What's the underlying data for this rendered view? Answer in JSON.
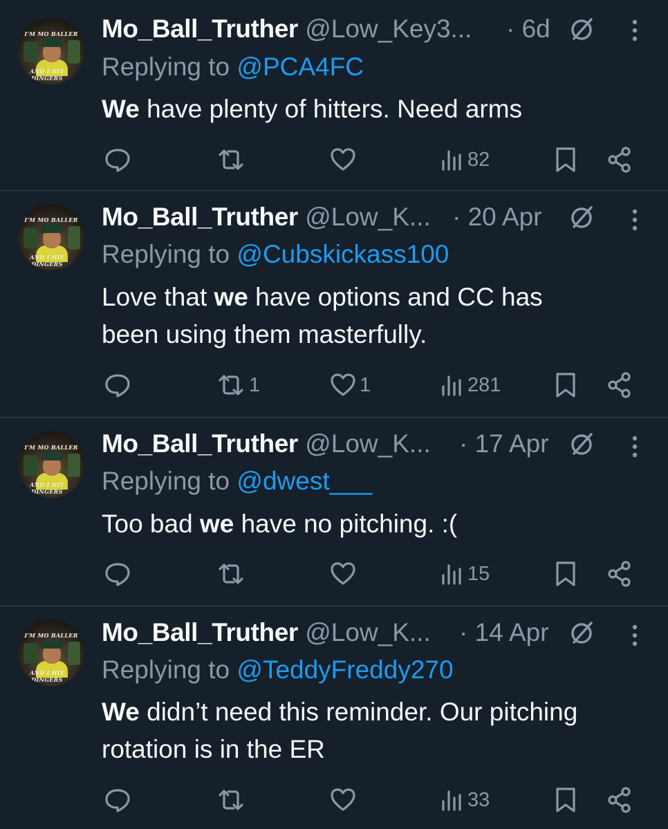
{
  "avatar": {
    "top_text": "I'M MO BALLER",
    "bottom_text": "AND I HIT DINGERS"
  },
  "tweets": [
    {
      "name": "Mo_Ball_Truther",
      "handle": "@Low_Key3...",
      "time": "· 6d",
      "replying_label": "Replying to",
      "replying_to": "@PCA4FC",
      "text_bold": "We",
      "text_rest": " have plenty of hitters. Need arms",
      "text_line2": "",
      "replies": "",
      "retweets": "",
      "likes": "",
      "views": "82"
    },
    {
      "name": "Mo_Ball_Truther",
      "handle": "@Low_K...",
      "time": "· 20 Apr",
      "replying_label": "Replying to",
      "replying_to": "@Cubskickass100",
      "text_pre": "Love that ",
      "text_bold": "we",
      "text_rest": " have options and CC has",
      "text_line2": "been using them masterfully.",
      "replies": "",
      "retweets": "1",
      "likes": "1",
      "views": "281"
    },
    {
      "name": "Mo_Ball_Truther",
      "handle": "@Low_K...",
      "time": "· 17 Apr",
      "replying_label": "Replying to",
      "replying_to": "@dwest___",
      "text_pre": "Too bad ",
      "text_bold": "we",
      "text_rest": " have no pitching. :(",
      "text_line2": "",
      "replies": "",
      "retweets": "",
      "likes": "",
      "views": "15"
    },
    {
      "name": "Mo_Ball_Truther",
      "handle": "@Low_K...",
      "time": "· 14 Apr",
      "replying_label": "Replying to",
      "replying_to": "@TeddyFreddy270",
      "text_bold": "We",
      "text_rest": " didn’t need this reminder. Our pitching",
      "text_line2": "rotation is in the ER",
      "replies": "",
      "retweets": "",
      "likes": "",
      "views": "33"
    }
  ],
  "icons": {
    "reply": "reply-icon",
    "retweet": "retweet-icon",
    "like": "heart-icon",
    "views": "views-icon",
    "bookmark": "bookmark-icon",
    "share": "share-icon",
    "badge": "grok-icon",
    "more": "more-icon"
  },
  "colors": {
    "background": "#15202b",
    "text": "#f7f9f9",
    "muted": "#8b98a5",
    "link": "#1d9bf0",
    "divider": "#38444d"
  }
}
